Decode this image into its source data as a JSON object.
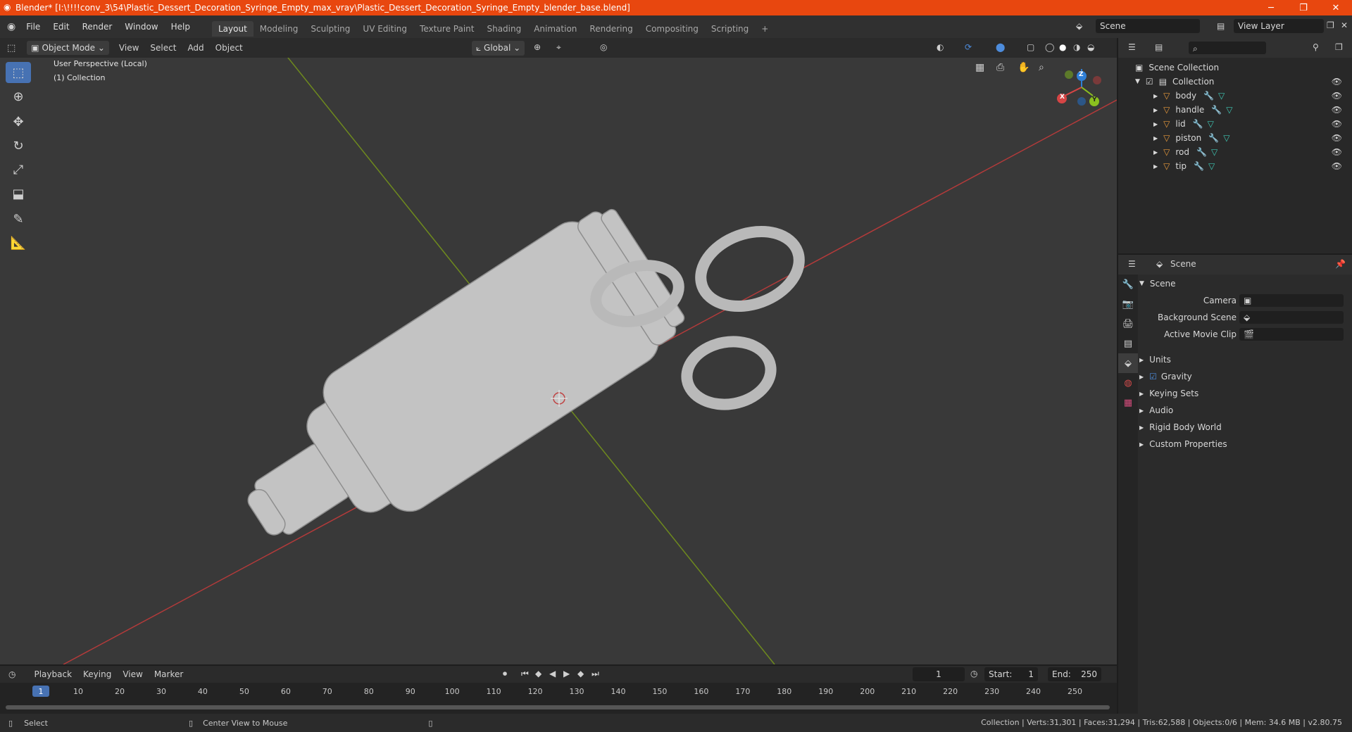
{
  "window": {
    "title": "Blender* [I:\\!!!!conv_3\\54\\Plastic_Dessert_Decoration_Syringe_Empty_max_vray\\Plastic_Dessert_Decoration_Syringe_Empty_blender_base.blend]",
    "minimize": "─",
    "maximize": "❐",
    "close": "✕"
  },
  "menu": [
    "File",
    "Edit",
    "Render",
    "Window",
    "Help"
  ],
  "workspaces": [
    "Layout",
    "Modeling",
    "Sculpting",
    "UV Editing",
    "Texture Paint",
    "Shading",
    "Animation",
    "Rendering",
    "Compositing",
    "Scripting"
  ],
  "workspace_add": "+",
  "scene_field": "Scene",
  "view_layer_field": "View Layer",
  "viewport": {
    "mode": "Object Mode",
    "menus": [
      "View",
      "Select",
      "Add",
      "Object"
    ],
    "transform_orientation": "Global",
    "overlay_text_1": "User Perspective (Local)",
    "overlay_text_2": "(1) Collection",
    "gizmo": {
      "x": "X",
      "y": "Y",
      "z": "Z"
    }
  },
  "outliner": {
    "root": "Scene Collection",
    "collection": "Collection",
    "objects": [
      "body",
      "handle",
      "lid",
      "piston",
      "rod",
      "tip"
    ]
  },
  "properties": {
    "header": "Scene",
    "panel_title": "Scene",
    "fields": [
      {
        "label": "Camera",
        "value": ""
      },
      {
        "label": "Background Scene",
        "value": ""
      },
      {
        "label": "Active Movie Clip",
        "value": ""
      }
    ],
    "sections": [
      "Units",
      "Gravity",
      "Keying Sets",
      "Audio",
      "Rigid Body World",
      "Custom Properties"
    ],
    "gravity_checked": true
  },
  "timeline": {
    "menus": [
      "Playback",
      "Keying",
      "View",
      "Marker"
    ],
    "current_frame": "1",
    "start_label": "Start:",
    "start": "1",
    "end_label": "End:",
    "end": "250",
    "ticks": [
      "1",
      "10",
      "20",
      "30",
      "40",
      "50",
      "60",
      "70",
      "80",
      "90",
      "100",
      "110",
      "120",
      "130",
      "140",
      "150",
      "160",
      "170",
      "180",
      "190",
      "200",
      "210",
      "220",
      "230",
      "240",
      "250"
    ]
  },
  "status": {
    "left": "Select",
    "middle": "Center View to Mouse",
    "right": "Collection | Verts:31,301 | Faces:31,294 | Tris:62,588 | Objects:0/6 | Mem: 34.6 MB | v2.80.75"
  },
  "colors": {
    "title_bar": "#e8470f",
    "accent": "#4772b3",
    "x_axis": "#b33a3a",
    "y_axis": "#6e8a1e",
    "mesh": "#c8c8c8"
  }
}
